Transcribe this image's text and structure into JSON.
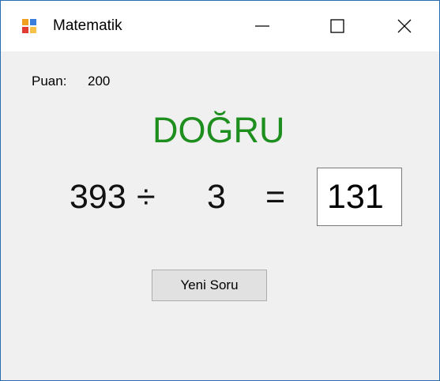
{
  "window": {
    "title": "Matematik",
    "icon": "app-windows-icon"
  },
  "titlebar_buttons": {
    "minimize_icon": "minimize-icon",
    "maximize_icon": "maximize-icon",
    "close_icon": "close-icon"
  },
  "score": {
    "label": "Puan:",
    "value": "200"
  },
  "result_text": "DOĞRU",
  "colors": {
    "result_green": "#1e8f1e",
    "window_border": "#2b6cb0"
  },
  "equation": {
    "operand1": "393",
    "operator": "÷",
    "operand2": "3",
    "equals": "=",
    "answer_value": "131"
  },
  "buttons": {
    "new_question": "Yeni Soru"
  }
}
